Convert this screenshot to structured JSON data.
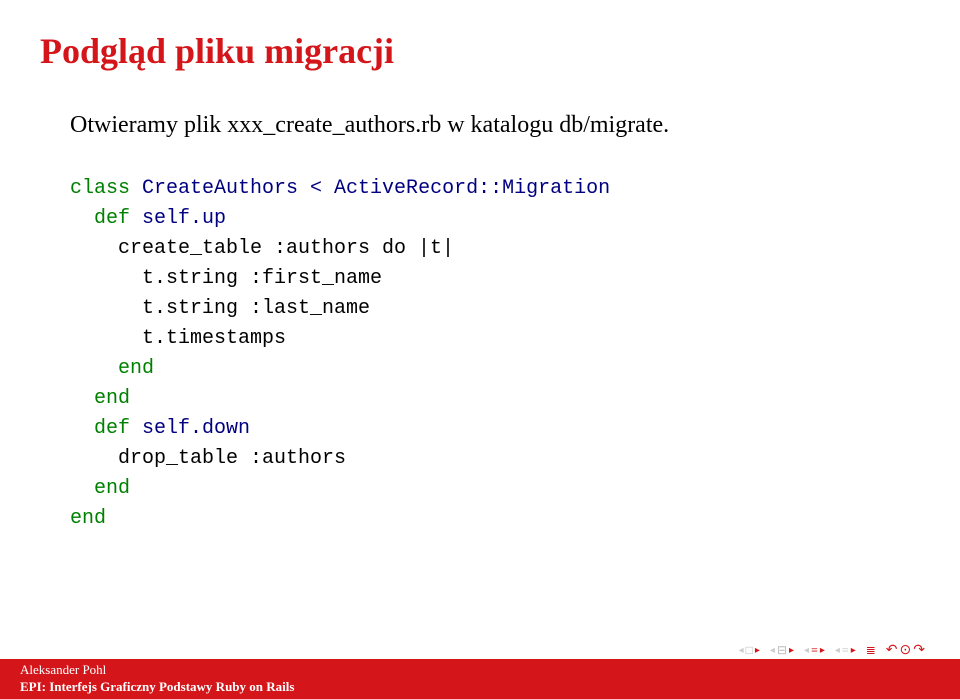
{
  "title": "Podgląd pliku migracji",
  "intro": "Otwieramy plik xxx_create_authors.rb w katalogu db/migrate.",
  "code": {
    "l1_class": "class",
    "l1_name": " CreateAuthors < ActiveRecord::Migration",
    "l2_def": "  def",
    "l2_name": " self.up",
    "l3": "    create_table :authors do |t|",
    "l4": "      t.string :first_name",
    "l5": "      t.string :last_name",
    "l6": "      t.timestamps",
    "l7_end": "    end",
    "l8_end": "  end",
    "blank": "",
    "l9_def": "  def",
    "l9_name": " self.down",
    "l10": "    drop_table :authors",
    "l11_end": "  end",
    "l12_end": "end"
  },
  "footer": {
    "author": "Aleksander Pohl",
    "subtitle": "EPI: Interfejs Graficzny Podstawy Ruby on Rails"
  }
}
